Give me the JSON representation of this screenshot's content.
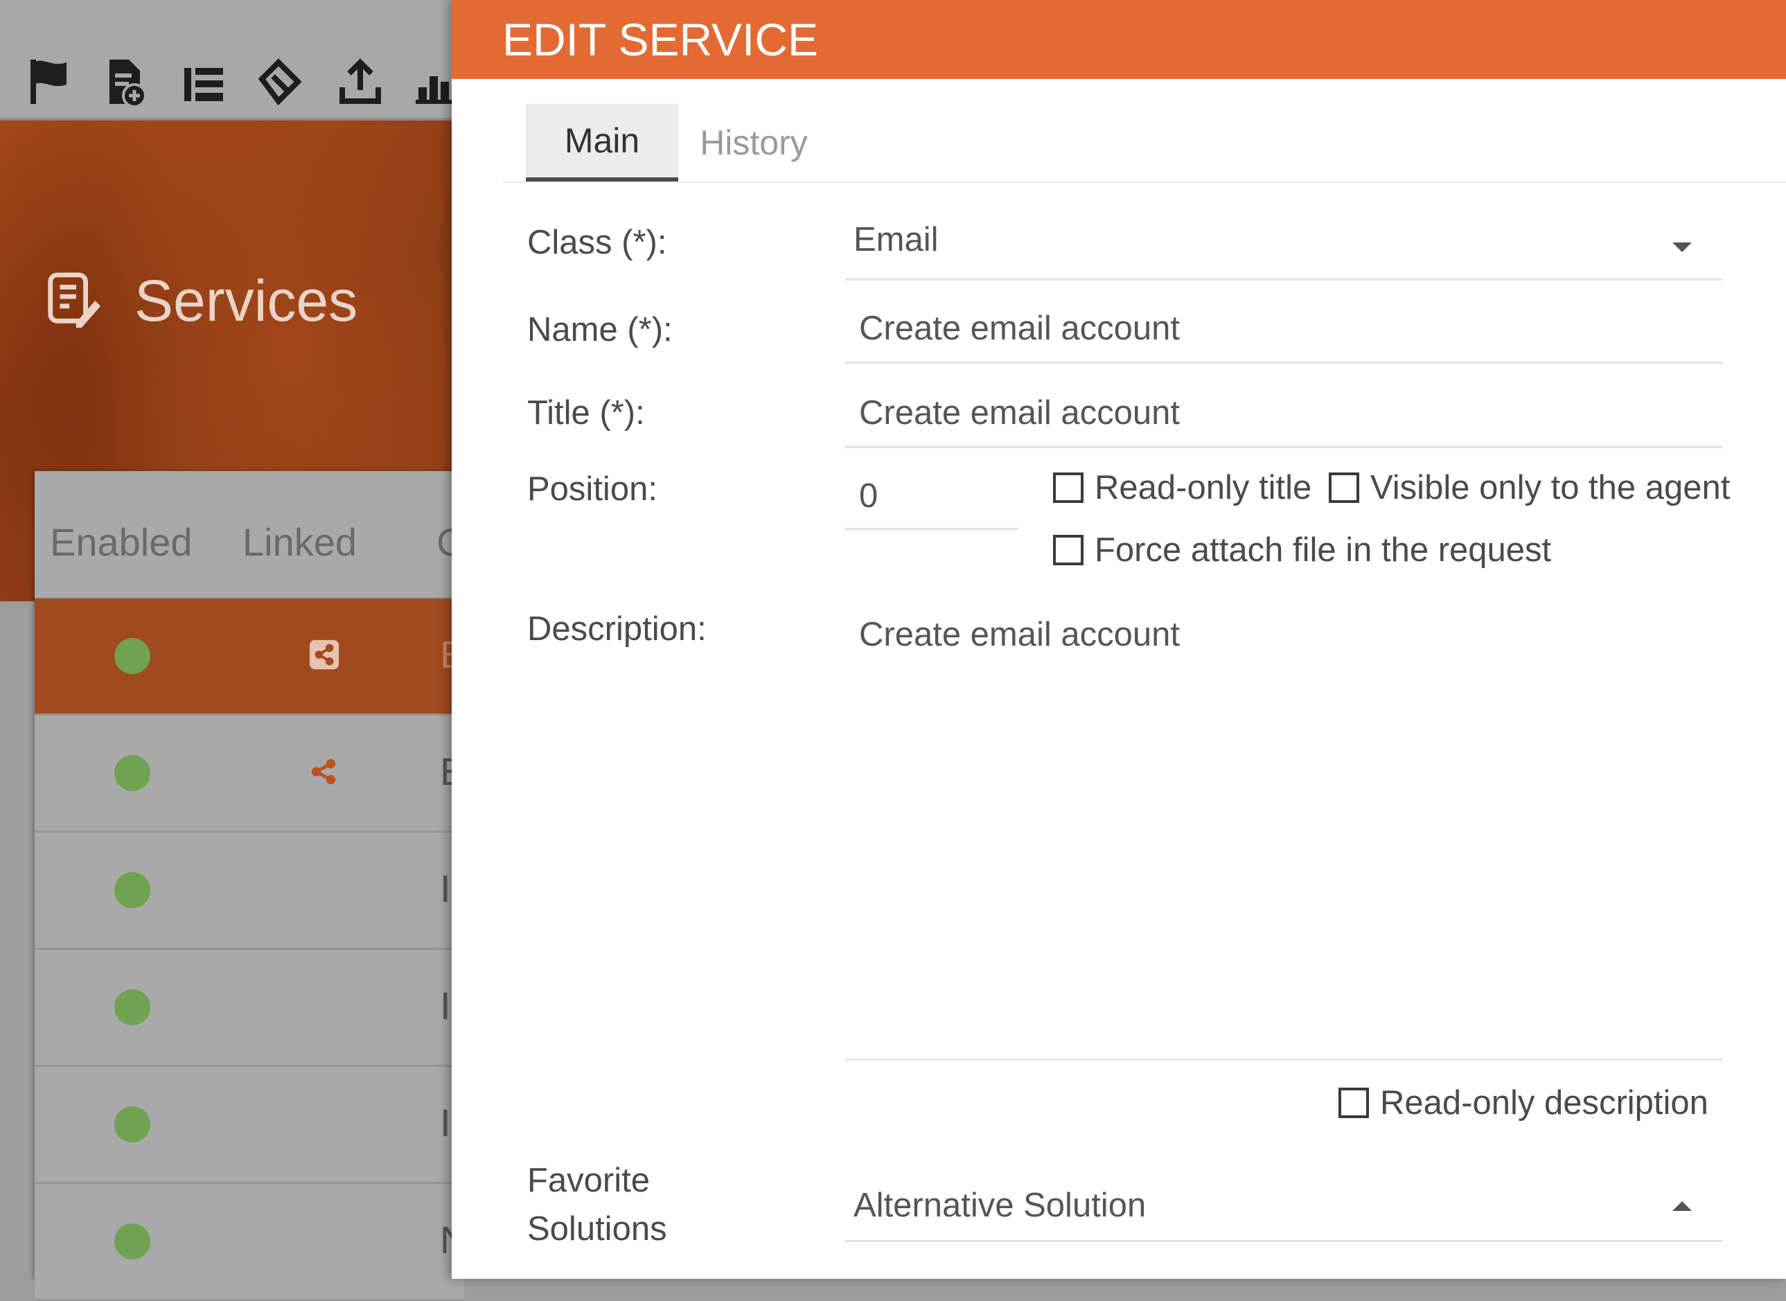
{
  "background": {
    "toolbar_icons": [
      "flag-icon",
      "document-add-icon",
      "list-icon",
      "tag-icon",
      "upload-icon",
      "bar-chart-icon"
    ],
    "page_title": "Services",
    "grid": {
      "columns": [
        "Enabled",
        "Linked",
        "C"
      ],
      "rows": [
        {
          "enabled": true,
          "linked": "share-icon",
          "cell": "E",
          "selected": true
        },
        {
          "enabled": true,
          "linked": "share-icon",
          "cell": "E",
          "selected": false
        },
        {
          "enabled": true,
          "linked": "",
          "cell": "I",
          "selected": false
        },
        {
          "enabled": true,
          "linked": "",
          "cell": "I",
          "selected": false
        },
        {
          "enabled": true,
          "linked": "",
          "cell": "I",
          "selected": false
        },
        {
          "enabled": true,
          "linked": "",
          "cell": "N",
          "selected": false
        }
      ]
    }
  },
  "modal": {
    "title": "EDIT SERVICE",
    "tabs": [
      {
        "label": "Main",
        "active": true
      },
      {
        "label": "History",
        "active": false
      }
    ],
    "form": {
      "class_label": "Class (*):",
      "class_value": "Email",
      "name_label": "Name (*):",
      "name_value": "Create email account",
      "title_label": "Title (*):",
      "title_value": "Create email account",
      "position_label": "Position:",
      "position_value": "0",
      "readonly_title_label": "Read-only title",
      "visible_agent_label": "Visible only to the agent",
      "force_attach_label": "Force attach file in the request",
      "description_label": "Description:",
      "description_value": "Create email account",
      "readonly_description_label": "Read-only description",
      "favorite_label_1": "Favorite",
      "favorite_label_2": "Solutions",
      "favorite_value": "Alternative Solution"
    },
    "colors": {
      "accent": "#e46a34",
      "selected_row": "#a24a1f",
      "enabled_dot": "#6fa251"
    }
  }
}
